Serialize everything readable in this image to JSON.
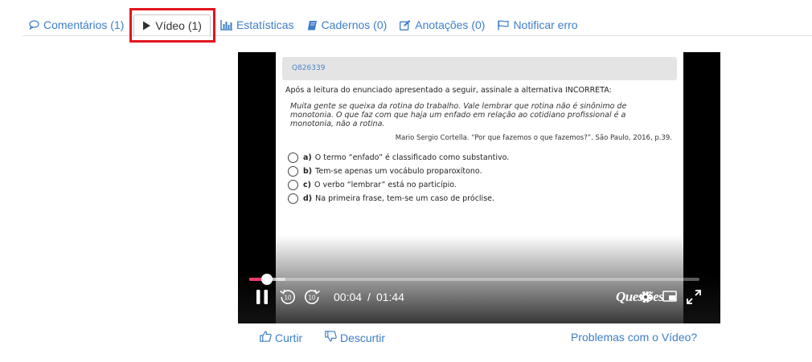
{
  "tabs": [
    {
      "label": "Comentários (1)",
      "icon": "comment-icon"
    },
    {
      "label": "Vídeo (1)",
      "icon": "play-icon"
    },
    {
      "label": "Estatísticas",
      "icon": "bar-chart-icon"
    },
    {
      "label": "Cadernos (0)",
      "icon": "book-icon"
    },
    {
      "label": "Anotações (0)",
      "icon": "edit-icon"
    },
    {
      "label": "Notificar erro",
      "icon": "flag-icon"
    }
  ],
  "active_tab": "Vídeo (1)",
  "colors": {
    "link": "#3d7ec9",
    "highlight": "#e3141d",
    "progress": "#f33b6b"
  },
  "video": {
    "question_id": "Q826339",
    "prompt": "Após a leitura do enunciado apresentado a seguir, assinale a alternativa INCORRETA:",
    "quote": "Muita gente se queixa da rotina do trabalho. Vale lembrar que rotina não é sinônimo de monotonia. O que faz com que haja um enfado em relação ao cotidiano profissional é a monotonia, não a rotina.",
    "source": "Mario Sergio Cortella. “Por que fazemos o que fazemos?”. São Paulo, 2016, p.39.",
    "options": [
      {
        "letter": "a)",
        "text": "O termo “enfado” é classificado como substantivo."
      },
      {
        "letter": "b)",
        "text": "Tem-se apenas um vocábulo proparoxítono."
      },
      {
        "letter": "c)",
        "text": "O verbo “lembrar” está no particípio."
      },
      {
        "letter": "d)",
        "text": "Na primeira frase, tem-se um caso de próclise."
      }
    ],
    "current_time": "00:04",
    "separator": "/",
    "duration": "01:44",
    "progress_fraction": 0.0385,
    "buffer_fraction": 0.08,
    "rewind_seconds": "10",
    "forward_seconds": "10",
    "logo_text": "Questões"
  },
  "actions": {
    "like": "Curtir",
    "dislike": "Descurtir",
    "problems": "Problemas com o Vídeo?"
  }
}
